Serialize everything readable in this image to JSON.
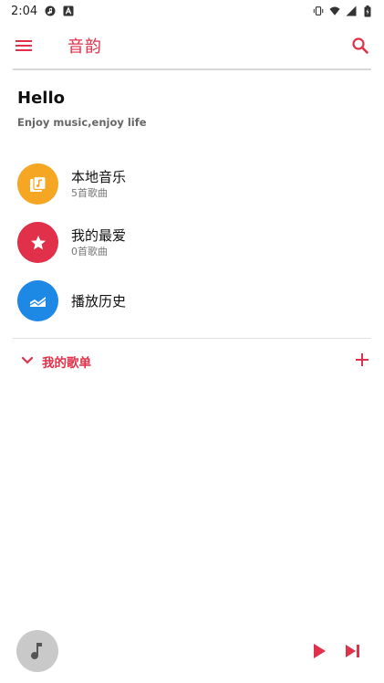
{
  "status_bar": {
    "time": "2:04",
    "left_icons": [
      "music-notification-icon",
      "a-notification-icon"
    ],
    "right_icons": [
      "vibrate-icon",
      "wifi-icon",
      "signal-icon",
      "battery-icon"
    ]
  },
  "app_bar": {
    "title": "音韵",
    "menu_icon": "hamburger-menu-icon",
    "search_icon": "search-icon"
  },
  "header": {
    "greeting": "Hello",
    "tagline": "Enjoy music,enjoy life"
  },
  "categories": [
    {
      "title": "本地音乐",
      "subtitle": "5首歌曲",
      "icon": "local-music-icon",
      "color": "#F5A623"
    },
    {
      "title": "我的最爱",
      "subtitle": "0首歌曲",
      "icon": "star-icon",
      "color": "#E0304A"
    },
    {
      "title": "播放历史",
      "subtitle": "",
      "icon": "history-chart-icon",
      "color": "#1E88E5"
    }
  ],
  "playlists": {
    "label": "我的歌单",
    "toggle_icon": "chevron-down-icon",
    "add_icon": "add-icon"
  },
  "player": {
    "art_icon": "music-note-icon",
    "play_icon": "play-icon",
    "next_icon": "skip-next-icon"
  },
  "colors": {
    "accent": "#E0304A",
    "divider": "#D8D8D8",
    "art_bg": "#C9C9C9"
  }
}
